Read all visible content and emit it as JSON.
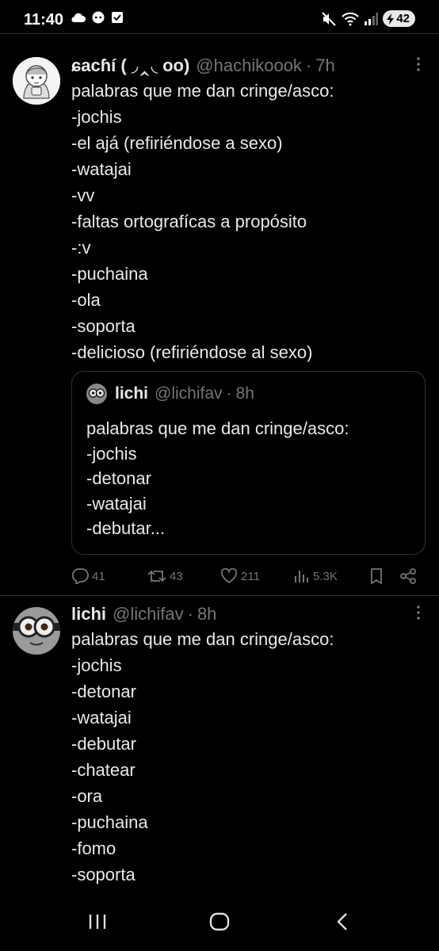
{
  "status_bar": {
    "time": "11:40",
    "battery": "42",
    "icons": [
      "cloud-icon",
      "discord-icon",
      "checkbox-icon",
      "mute-icon",
      "wifi-icon",
      "signal-icon",
      "battery-icon"
    ]
  },
  "tweet1": {
    "display_name": "ɕacɦí ( ◞‸◟ oo)",
    "handle": "@hachikoook",
    "separator": "·",
    "time": "7h",
    "lines": [
      "palabras que me dan cringe/asco:",
      "-jochis",
      "-el ajá (refiriéndose a sexo)",
      "-watajai",
      "-vv",
      "-faltas ortografícas a propósito",
      "-:v",
      "-puchaina",
      "-ola",
      "-soporta",
      "-delicioso (refiriéndose al sexo)"
    ],
    "quote": {
      "display_name": "lichi",
      "handle": "@lichifav",
      "separator": "·",
      "time": "8h",
      "lines": [
        "palabras que me dan cringe/asco:",
        "-jochis",
        "-detonar",
        "-watajai",
        "-debutar..."
      ]
    },
    "actions": {
      "replies": "41",
      "retweets": "43",
      "likes": "211",
      "views": "5.3K"
    }
  },
  "tweet2": {
    "display_name": "lichi",
    "handle": "@lichifav",
    "separator": "·",
    "time": "8h",
    "lines": [
      "palabras que me dan cringe/asco:",
      "-jochis",
      "-detonar",
      "-watajai",
      "-debutar",
      "-chatear",
      "-ora",
      "-puchaina",
      "-fomo",
      "-soporta"
    ]
  },
  "colors": {
    "background": "#000000",
    "text": "#e7e9ea",
    "muted": "#71767b",
    "border": "#2f3336"
  }
}
